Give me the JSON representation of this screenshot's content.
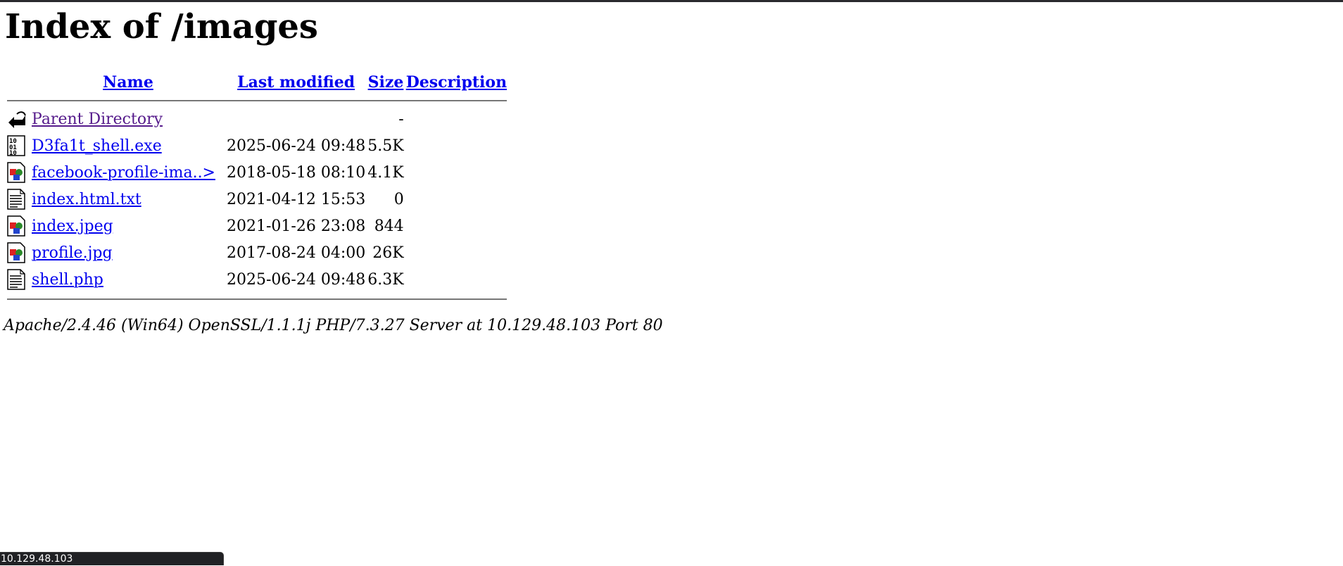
{
  "page": {
    "heading": "Index of /images",
    "server_signature": "Apache/2.4.46 (Win64) OpenSSL/1.1.1j PHP/7.3.27 Server at 10.129.48.103 Port 80"
  },
  "table": {
    "headers": {
      "name": "Name",
      "modified": "Last modified",
      "size": "Size",
      "description": "Description"
    },
    "parent": {
      "name": "Parent Directory",
      "size": "-",
      "icon": "back-arrow-icon"
    },
    "rows": [
      {
        "name": "D3fa1t_shell.exe",
        "modified": "2025-06-24 09:48",
        "size": "5.5K",
        "description": "",
        "icon": "binary-icon"
      },
      {
        "name": "facebook-profile-ima..>",
        "modified": "2018-05-18 08:10",
        "size": "4.1K",
        "description": "",
        "icon": "image-icon"
      },
      {
        "name": "index.html.txt",
        "modified": "2021-04-12 15:53",
        "size": "0",
        "description": "",
        "icon": "text-icon"
      },
      {
        "name": "index.jpeg",
        "modified": "2021-01-26 23:08",
        "size": "844",
        "description": "",
        "icon": "image-icon"
      },
      {
        "name": "profile.jpg",
        "modified": "2017-08-24 04:00",
        "size": "26K",
        "description": "",
        "icon": "image-icon"
      },
      {
        "name": "shell.php",
        "modified": "2025-06-24 09:48",
        "size": "6.3K",
        "description": "",
        "icon": "text-icon"
      }
    ]
  },
  "statusbar": {
    "url": "10.129.48.103"
  },
  "colors": {
    "link": "#0000ee",
    "visited_link": "#551a8b",
    "statusbar_bg": "#202124"
  }
}
